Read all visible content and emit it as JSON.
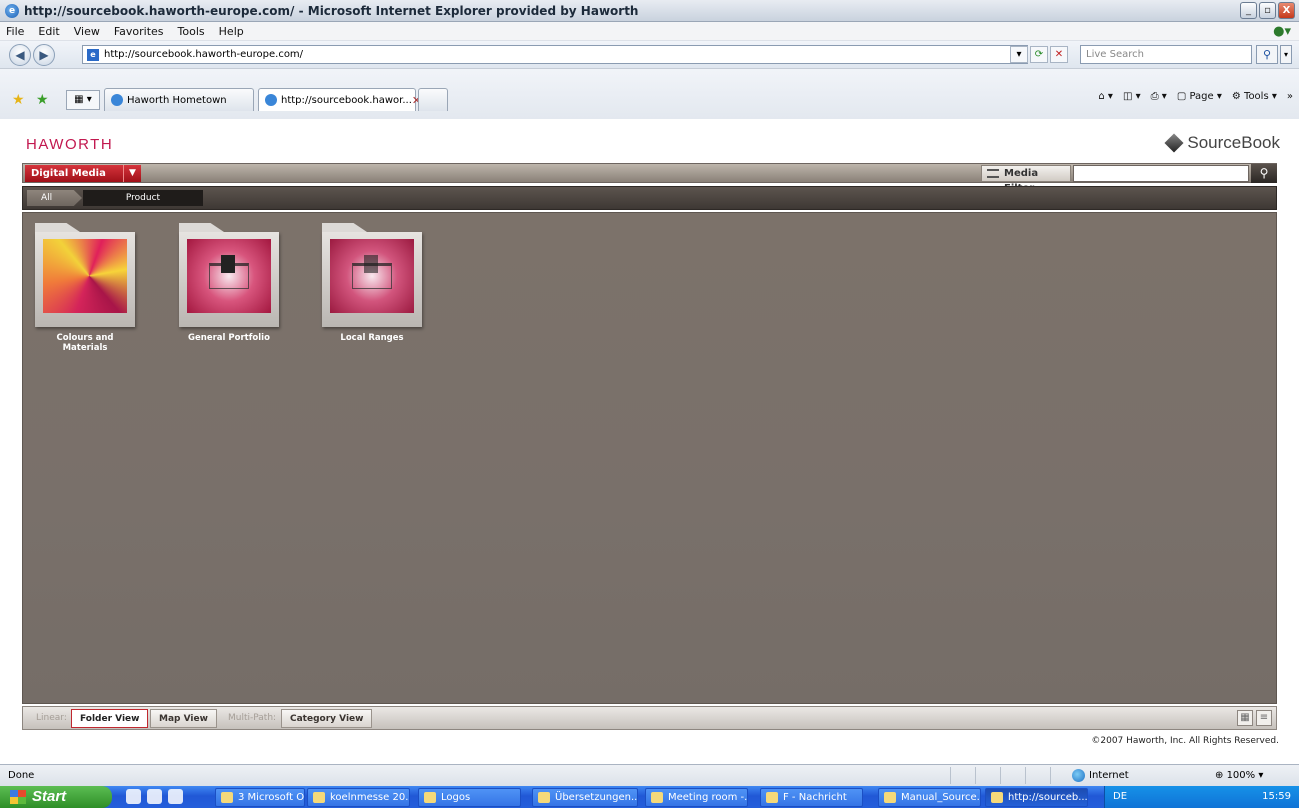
{
  "window": {
    "title": "http://sourcebook.haworth-europe.com/ - Microsoft Internet Explorer provided by Haworth",
    "controls": [
      "_",
      "▫",
      "X"
    ]
  },
  "menu": [
    "File",
    "Edit",
    "View",
    "Favorites",
    "Tools",
    "Help"
  ],
  "address": {
    "url": "http://sourcebook.haworth-europe.com/",
    "search_placeholder": "Live Search"
  },
  "tabs": [
    {
      "label": "Haworth Hometown",
      "active": false
    },
    {
      "label": "http://sourcebook.hawor...",
      "active": true
    }
  ],
  "command_bar": {
    "page": "Page",
    "tools": "Tools"
  },
  "site": {
    "logo": "HAWORTH",
    "sourcebook": "SourceBook",
    "digital_media": "Digital Media",
    "media_filter": "Media Filter",
    "breadcrumbs": [
      "All",
      "Product"
    ],
    "folders": [
      {
        "label": "Colours and Materials"
      },
      {
        "label": "General Portfolio"
      },
      {
        "label": "Local Ranges"
      }
    ],
    "view_bar": {
      "linear_label": "Linear:",
      "folder_view": "Folder View",
      "map_view": "Map View",
      "multipath_label": "Multi-Path:",
      "category_view": "Category View"
    },
    "copyright": "©2007 Haworth, Inc. All Rights Reserved."
  },
  "status": {
    "text": "Done",
    "zone": "Internet",
    "zoom": "100%"
  },
  "taskbar": {
    "start": "Start",
    "items": [
      {
        "label": "3 Microsoft O..."
      },
      {
        "label": "koelnmesse 20..."
      },
      {
        "label": "Logos"
      },
      {
        "label": "Übersetzungen..."
      },
      {
        "label": "Meeting room -..."
      },
      {
        "label": "F - Nachricht"
      },
      {
        "label": "Manual_Source..."
      },
      {
        "label": "http://sourceb..."
      }
    ],
    "lang": "DE",
    "clock": "15:59"
  },
  "colors": {
    "brand": "#c2184f",
    "accent_red": "#c0282f",
    "content_bg": "#7a706a"
  }
}
